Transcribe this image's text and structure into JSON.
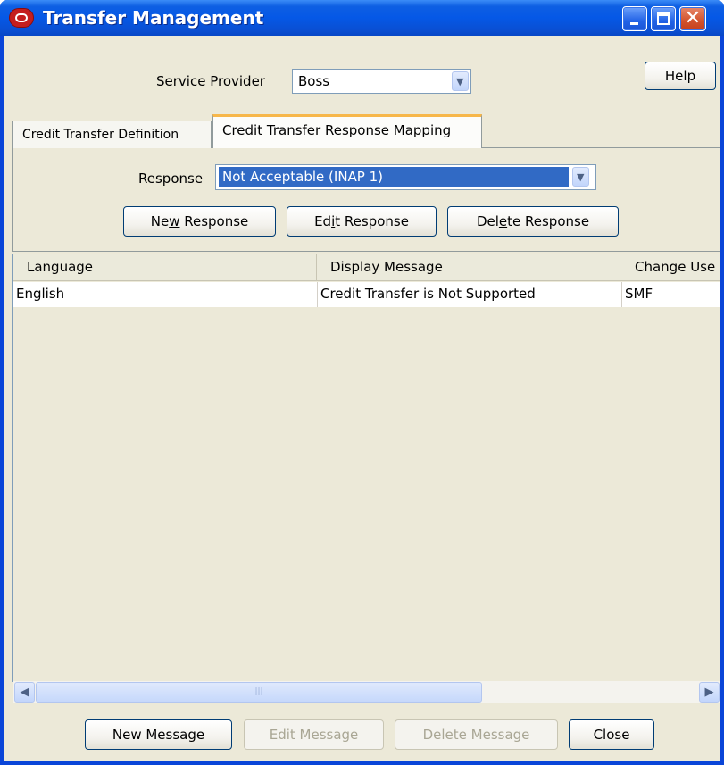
{
  "window": {
    "title": "Transfer Management",
    "buttons": {
      "minimize": "minimize",
      "maximize": "maximize",
      "close": "✕"
    }
  },
  "service_provider": {
    "label": "Service Provider",
    "value": "Boss"
  },
  "help_label": "Help",
  "tabs": [
    {
      "label": "Credit Transfer Definition",
      "active": false
    },
    {
      "label": "Credit Transfer Response Mapping",
      "active": true
    }
  ],
  "response": {
    "label": "Response",
    "value": "Not Acceptable (INAP 1)"
  },
  "response_buttons": {
    "new": {
      "pre": "Ne",
      "mnemonic": "w",
      "post": " Response"
    },
    "edit": {
      "pre": "Ed",
      "mnemonic": "i",
      "post": "t Response"
    },
    "delete": {
      "pre": "Del",
      "mnemonic": "e",
      "post": "te Response"
    }
  },
  "table": {
    "columns": [
      "Language",
      "Display Message",
      "Change Use"
    ],
    "rows": [
      [
        "English",
        "Credit Transfer is Not Supported",
        "SMF"
      ]
    ]
  },
  "scrollbar": {
    "thumb_grip": "|||"
  },
  "footer_buttons": {
    "new_message": "New Message",
    "edit_message": "Edit Message",
    "delete_message": "Delete Message",
    "close": "Close"
  },
  "colors": {
    "titlebar": "#0558e6",
    "selection": "#316ac5",
    "client": "#ece9d8"
  }
}
